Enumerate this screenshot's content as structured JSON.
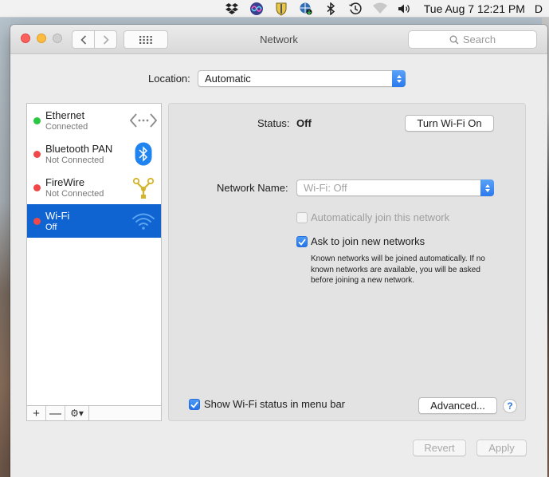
{
  "menubar": {
    "icons": [
      "dropbox-icon",
      "siri-icon",
      "security-shield-icon",
      "network-monitor-icon",
      "bluetooth-icon",
      "time-machine-icon",
      "wifi-icon",
      "volume-icon"
    ],
    "clock": "Tue Aug 7  12:21 PM",
    "trailing": "D"
  },
  "window": {
    "title": "Network",
    "search_placeholder": "Search"
  },
  "location": {
    "label": "Location:",
    "value": "Automatic"
  },
  "services": [
    {
      "name": "Ethernet",
      "status": "Connected",
      "dot_color": "#2ac840",
      "icon": "ethernet-icon",
      "selected": false
    },
    {
      "name": "Bluetooth PAN",
      "status": "Not Connected",
      "dot_color": "#f04848",
      "icon": "bluetooth-icon",
      "selected": false
    },
    {
      "name": "FireWire",
      "status": "Not Connected",
      "dot_color": "#f04848",
      "icon": "firewire-icon",
      "selected": false
    },
    {
      "name": "Wi-Fi",
      "status": "Off",
      "dot_color": "#f04848",
      "icon": "wifi-icon",
      "selected": true
    }
  ],
  "sidebar_tools": {
    "add": "+",
    "remove": "—",
    "gear": "⚙︎▾"
  },
  "detail": {
    "status_label": "Status:",
    "status_value": "Off",
    "toggle_button": "Turn Wi-Fi On",
    "network_name_label": "Network Name:",
    "network_name_value": "Wi-Fi: Off",
    "auto_join_label": "Automatically join this network",
    "auto_join_checked": false,
    "ask_join_label": "Ask to join new networks",
    "ask_join_checked": true,
    "ask_join_hint": "Known networks will be joined automatically. If no known networks are available, you will be asked before joining a new network.",
    "show_status_label": "Show Wi-Fi status in menu bar",
    "show_status_checked": true,
    "advanced_button": "Advanced...",
    "help_button": "?"
  },
  "footer": {
    "revert_button": "Revert",
    "apply_button": "Apply"
  },
  "colors": {
    "accent": "#0f64d2",
    "status_connected": "#2ac840",
    "status_off": "#f04848"
  }
}
